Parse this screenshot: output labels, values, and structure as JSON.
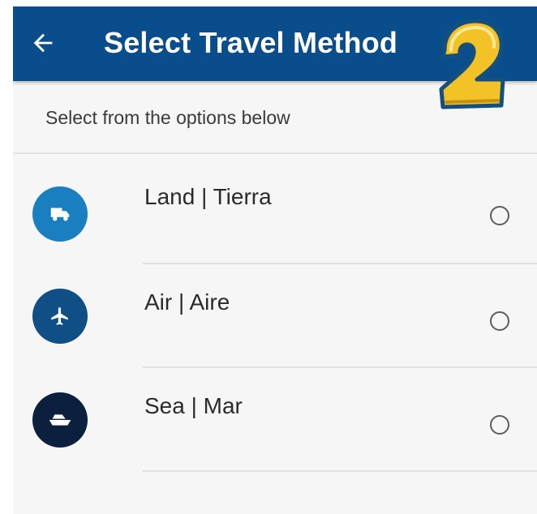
{
  "appbar": {
    "back_icon": "arrow-left-icon",
    "title": "Select Travel Method",
    "background_color": "#0a4d8c"
  },
  "step_badge": {
    "number": "2"
  },
  "subtitle": "Select from the options below",
  "options": [
    {
      "label": "Land | Tierra",
      "icon": "truck-icon",
      "icon_color": "#1a7fc1",
      "selected": false
    },
    {
      "label": "Air | Aire",
      "icon": "airplane-icon",
      "icon_color": "#0f4f86",
      "selected": false
    },
    {
      "label": "Sea | Mar",
      "icon": "ship-icon",
      "icon_color": "#0b1f3f",
      "selected": false
    }
  ]
}
